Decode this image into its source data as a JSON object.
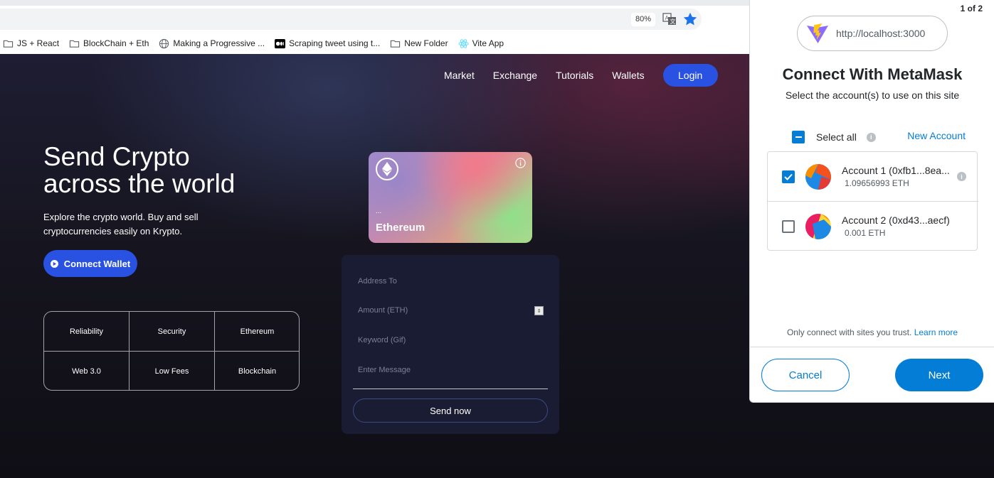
{
  "browser": {
    "zoom": "80%",
    "bookmarks": [
      {
        "label": "JS + React",
        "icon": "folder-icon"
      },
      {
        "label": "BlockChain + Eth",
        "icon": "folder-icon"
      },
      {
        "label": "Making a Progressive ...",
        "icon": "globe-icon"
      },
      {
        "label": "Scraping tweet using t...",
        "icon": "medium-icon"
      },
      {
        "label": "New Folder",
        "icon": "folder-icon"
      },
      {
        "label": "Vite App",
        "icon": "react-icon"
      }
    ]
  },
  "site": {
    "nav": [
      "Market",
      "Exchange",
      "Tutorials",
      "Wallets"
    ],
    "login_label": "Login",
    "hero_title_line1": "Send Crypto",
    "hero_title_line2": "across the world",
    "hero_sub": "Explore the crypto world. Buy and sell cryptocurrencies easily on Krypto.",
    "connect_label": "Connect Wallet",
    "features": [
      "Reliability",
      "Security",
      "Ethereum",
      "Web 3.0",
      "Low Fees",
      "Blockchain"
    ],
    "card": {
      "address": "...",
      "name": "Ethereum"
    },
    "form": {
      "address_placeholder": "Address To",
      "amount_placeholder": "Amount (ETH)",
      "keyword_placeholder": "Keyword (Gif)",
      "message_placeholder": "Enter Message",
      "send_label": "Send now"
    }
  },
  "metamask": {
    "page_count": "1 of 2",
    "origin": "http://localhost:3000",
    "title": "Connect With MetaMask",
    "subtitle": "Select the account(s) to use on this site",
    "select_all": "Select all",
    "new_account": "New Account",
    "accounts": [
      {
        "name": "Account 1 (0xfb1...8ea...",
        "balance": "1.09656993 ETH",
        "checked": true
      },
      {
        "name": "Account 2 (0xd43...aecf)",
        "balance": "0.001 ETH",
        "checked": false
      }
    ],
    "trust_text": "Only connect with sites you trust.",
    "learn_more": "Learn more",
    "cancel_label": "Cancel",
    "next_label": "Next",
    "accent_color": "#037dd6"
  }
}
